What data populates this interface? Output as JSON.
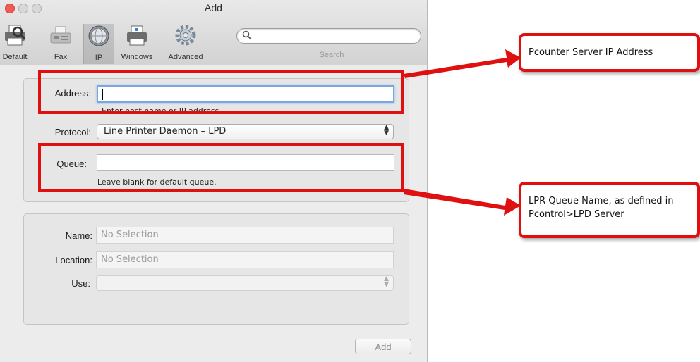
{
  "window": {
    "title": "Add"
  },
  "toolbar": {
    "items": [
      {
        "label": "Default",
        "icon": "default-printer-icon"
      },
      {
        "label": "Fax",
        "icon": "fax-icon"
      },
      {
        "label": "IP",
        "icon": "globe-icon",
        "selected": true
      },
      {
        "label": "Windows",
        "icon": "windows-printer-icon"
      },
      {
        "label": "Advanced",
        "icon": "gear-icon"
      }
    ],
    "search": {
      "label": "Search",
      "value": ""
    }
  },
  "ip_form": {
    "address": {
      "label": "Address:",
      "value": "",
      "hint": "Enter host name or IP address."
    },
    "protocol": {
      "label": "Protocol:",
      "value": "Line Printer Daemon – LPD"
    },
    "queue": {
      "label": "Queue:",
      "value": "",
      "hint": "Leave blank for default queue."
    }
  },
  "printer_info": {
    "name": {
      "label": "Name:",
      "placeholder": "No Selection"
    },
    "location": {
      "label": "Location:",
      "placeholder": "No Selection"
    },
    "use": {
      "label": "Use:",
      "value": ""
    }
  },
  "buttons": {
    "add": "Add"
  },
  "annotations": {
    "address_callout": "Pcounter Server IP Address",
    "queue_callout_line1": "LPR Queue Name, as defined in",
    "queue_callout_line2": "Pcontrol>LPD Server",
    "color": "#e01010"
  }
}
